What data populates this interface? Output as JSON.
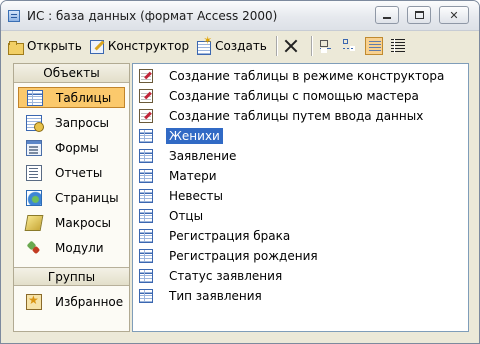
{
  "window": {
    "title": "ИС : база данных (формат Access 2000)",
    "controls": {
      "minimize": "minimize-icon",
      "maximize": "maximize-icon",
      "close": "✕"
    }
  },
  "toolbar": {
    "open_label": "Открыть",
    "design_label": "Конструктор",
    "new_label": "Создать",
    "view_icons": [
      "delete-icon",
      "large-icons-view-icon",
      "small-icons-view-icon",
      "list-view-icon",
      "details-view-icon"
    ]
  },
  "sidebar": {
    "objects_header": "Объекты",
    "items": [
      {
        "label": "Таблицы",
        "icon": "table-icon",
        "selected": true
      },
      {
        "label": "Запросы",
        "icon": "query-icon"
      },
      {
        "label": "Формы",
        "icon": "form-icon"
      },
      {
        "label": "Отчеты",
        "icon": "report-icon"
      },
      {
        "label": "Страницы",
        "icon": "page-icon"
      },
      {
        "label": "Макросы",
        "icon": "macro-icon"
      },
      {
        "label": "Модули",
        "icon": "module-icon"
      }
    ],
    "groups_header": "Группы",
    "groups": [
      {
        "label": "Избранное",
        "icon": "favorites-icon"
      }
    ]
  },
  "list": {
    "items": [
      {
        "label": "Создание таблицы в режиме конструктора",
        "icon": "wizard-icon"
      },
      {
        "label": "Создание таблицы с помощью мастера",
        "icon": "wizard-icon"
      },
      {
        "label": "Создание таблицы путем ввода данных",
        "icon": "wizard-icon"
      },
      {
        "label": "Женихи",
        "icon": "table-icon",
        "selected": true
      },
      {
        "label": "Заявление",
        "icon": "table-icon"
      },
      {
        "label": "Матери",
        "icon": "table-icon"
      },
      {
        "label": "Невесты",
        "icon": "table-icon"
      },
      {
        "label": "Отцы",
        "icon": "table-icon"
      },
      {
        "label": "Регистрация брака",
        "icon": "table-icon"
      },
      {
        "label": "Регистрация рождения",
        "icon": "table-icon"
      },
      {
        "label": "Статус заявления",
        "icon": "table-icon"
      },
      {
        "label": "Тип заявления",
        "icon": "table-icon"
      }
    ]
  },
  "colors": {
    "selection": "#316ac5",
    "sidebar_selection": "#fbc96c",
    "window_bg": "#ece9d8"
  }
}
